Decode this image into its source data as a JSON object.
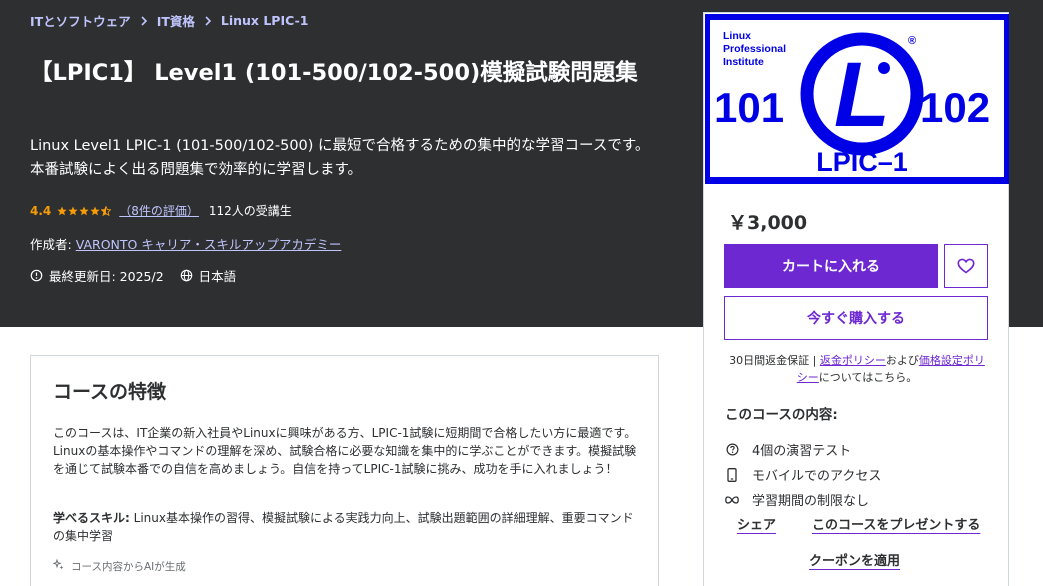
{
  "breadcrumb": [
    "ITとソフトウェア",
    "IT資格",
    "Linux LPIC-1"
  ],
  "course": {
    "title": "【LPIC1】 Level1 (101-500/102-500)模擬試験問題集",
    "headline": "Linux Level1 LPIC-1 (101-500/102-500) に最短で合格するための集中的な学習コースです。本番試験によく出る問題集で効率的に学習します。",
    "rating": "4.4",
    "rating_value": 4.4,
    "rating_count": "（8件の評価）",
    "students": "112人の受講生",
    "author_label": "作成者:",
    "author": "VARONTO キャリア・スキルアップアカデミー",
    "updated": "最終更新日: 2025/2",
    "language": "日本語"
  },
  "thumbnail": {
    "top_left": [
      "Linux",
      "Professional",
      "Institute"
    ],
    "left_number": "101",
    "right_number": "102",
    "center_letter": "L",
    "bottom": "LPIC–1",
    "registered": "®",
    "colors": {
      "blue": "#0000e6",
      "white": "#ffffff"
    }
  },
  "card": {
    "price": "￥3,000",
    "add_to_cart": "カートに入れる",
    "buy_now": "今すぐ購入する",
    "guarantee_prefix": "30日間返金保証 | ",
    "refund_policy": "返金ポリシー",
    "and": "および",
    "pricing_policy": "価格設定ポリシー",
    "guarantee_suffix": "についてはこちら。",
    "includes_title": "このコースの内容:",
    "includes": [
      {
        "icon": "question-circle-icon",
        "label": "4個の演習テスト"
      },
      {
        "icon": "mobile-phone-icon",
        "label": "モバイルでのアクセス"
      },
      {
        "icon": "infinity-icon",
        "label": "学習期間の制限なし"
      }
    ],
    "share": "シェア",
    "gift": "このコースをプレゼントする",
    "coupon": "クーポンを適用"
  },
  "features": {
    "title": "コースの特徴",
    "description": "このコースは、IT企業の新入社員やLinuxに興味がある方、LPIC-1試験に短期間で合格したい方に最適です。Linuxの基本操作やコマンドの理解を深め、試験合格に必要な知識を集中的に学ぶことができます。模擬試験を通じて試験本番での自信を高めましょう。自信を持ってLPIC-1試験に挑み、成功を手に入れましょう！",
    "skills_label": "学べるスキル:",
    "skills": " Linux基本操作の習得、模擬試験による実践力向上、試験出題範囲の詳細理解、重要コマンドの集中学習",
    "ai_note": "コース内容からAIが生成"
  },
  "colors": {
    "hero_bg": "#2d2f31",
    "accent": "#6d28d2",
    "link_light": "#c0c4fc",
    "star": "#f69c08"
  }
}
